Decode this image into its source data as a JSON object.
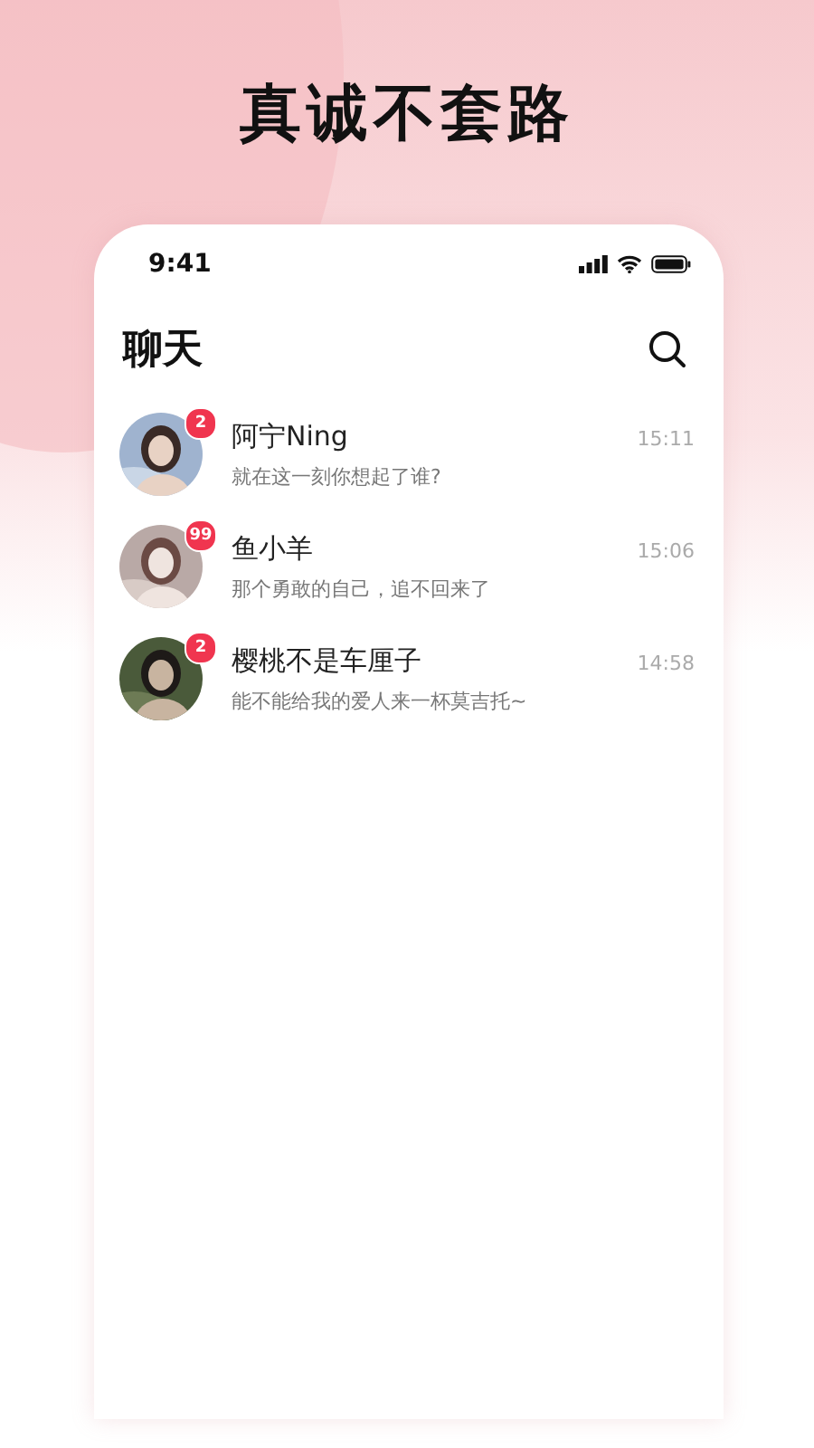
{
  "headline": "真诚不套路",
  "status_bar": {
    "time": "9:41"
  },
  "header": {
    "title": "聊天"
  },
  "chats": [
    {
      "name": "阿宁Ning",
      "message": "就在这一刻你想起了谁?",
      "time": "15:11",
      "badge": "2"
    },
    {
      "name": "鱼小羊",
      "message": "那个勇敢的自己，追不回来了",
      "time": "15:06",
      "badge": "99"
    },
    {
      "name": "樱桃不是车厘子",
      "message": "能不能给我的爱人来一杯莫吉托~",
      "time": "14:58",
      "badge": "2"
    }
  ]
}
